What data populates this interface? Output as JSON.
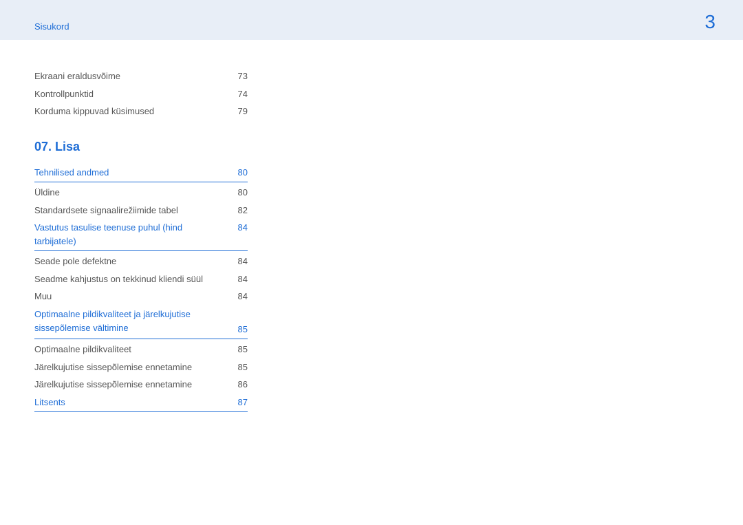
{
  "header": {
    "breadcrumb": "Sisukord",
    "page_number": "3"
  },
  "toc": {
    "preitems": [
      {
        "label": "Ekraani eraldusvõime",
        "page": "73"
      },
      {
        "label": "Kontrollpunktid",
        "page": "74"
      },
      {
        "label": "Korduma kippuvad küsimused",
        "page": "79"
      }
    ],
    "section_title": "07.  Lisa",
    "groups": [
      {
        "heading": {
          "label": "Tehnilised andmed",
          "page": "80"
        },
        "items": [
          {
            "label": "Üldine",
            "page": "80"
          },
          {
            "label": "Standardsete signaalirežiimide tabel",
            "page": "82"
          }
        ]
      },
      {
        "heading": {
          "label": "Vastutus tasulise teenuse puhul (hind tarbijatele)",
          "page": "84"
        },
        "items": [
          {
            "label": "Seade pole defektne",
            "page": "84"
          },
          {
            "label": "Seadme kahjustus on tekkinud kliendi süül",
            "page": "84"
          },
          {
            "label": "Muu",
            "page": "84"
          }
        ]
      },
      {
        "heading": {
          "label": "Optimaalne pildikvaliteet ja järelkujutise sissepõlemise vältimine",
          "page": "85"
        },
        "items": [
          {
            "label": "Optimaalne pildikvaliteet",
            "page": "85"
          },
          {
            "label": "Järelkujutise sissepõlemise ennetamine",
            "page": "85"
          },
          {
            "label": "Järelkujutise sissepõlemise ennetamine",
            "page": "86"
          }
        ]
      },
      {
        "heading": {
          "label": "Litsents",
          "page": "87"
        },
        "items": []
      }
    ]
  }
}
